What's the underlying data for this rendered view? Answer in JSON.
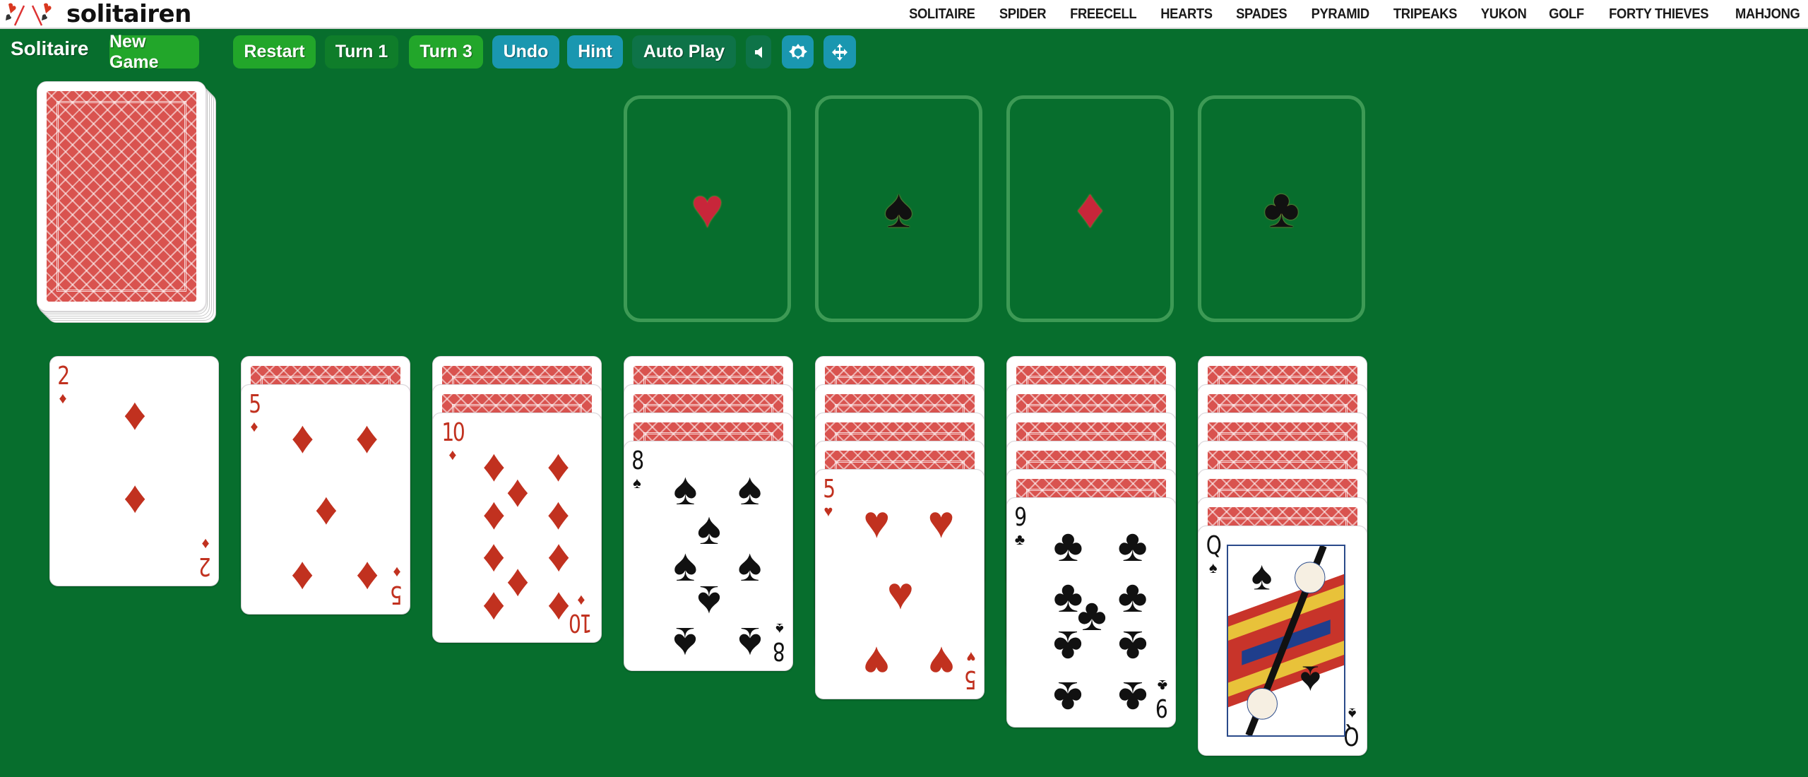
{
  "header": {
    "brand": "solitairen",
    "nav": [
      "SOLITAIRE",
      "SPIDER",
      "FREECELL",
      "HEARTS",
      "SPADES",
      "PYRAMID",
      "TRIPEAKS",
      "YUKON",
      "GOLF",
      "FORTY THIEVES",
      "MAHJONG"
    ]
  },
  "toolbar": {
    "title": "Solitaire",
    "new_game": "New Game",
    "restart": "Restart",
    "turn1": "Turn 1",
    "turn3": "Turn 3",
    "undo": "Undo",
    "hint": "Hint",
    "auto_play": "Auto Play",
    "selected_turn_mode": "Turn 3",
    "icons": [
      "sound-icon",
      "settings-gear-icon",
      "fullscreen-move-icon"
    ]
  },
  "stock": {
    "face_down": true
  },
  "foundations": [
    {
      "suit": "hearts",
      "symbol": "♥",
      "color": "#c8263a"
    },
    {
      "suit": "spades",
      "symbol": "♠",
      "color": "#111111"
    },
    {
      "suit": "diamonds",
      "symbol": "♦",
      "color": "#c8263a"
    },
    {
      "suit": "clubs",
      "symbol": "♣",
      "color": "#111111"
    }
  ],
  "tableau": [
    {
      "face_down": 0,
      "top": {
        "rank": "2",
        "suit": "♦",
        "color": "red"
      }
    },
    {
      "face_down": 1,
      "top": {
        "rank": "5",
        "suit": "♦",
        "color": "red"
      }
    },
    {
      "face_down": 2,
      "top": {
        "rank": "10",
        "suit": "♦",
        "color": "red"
      }
    },
    {
      "face_down": 3,
      "top": {
        "rank": "8",
        "suit": "♠",
        "color": "black"
      }
    },
    {
      "face_down": 4,
      "top": {
        "rank": "5",
        "suit": "♥",
        "color": "red"
      }
    },
    {
      "face_down": 5,
      "top": {
        "rank": "9",
        "suit": "♣",
        "color": "black"
      }
    },
    {
      "face_down": 6,
      "top": {
        "rank": "Q",
        "suit": "♠",
        "color": "black"
      }
    }
  ],
  "colors": {
    "felt": "#076e2d",
    "card_back": "#d9534f",
    "button_green": "#22a62a",
    "button_teal": "#1a97b0"
  }
}
